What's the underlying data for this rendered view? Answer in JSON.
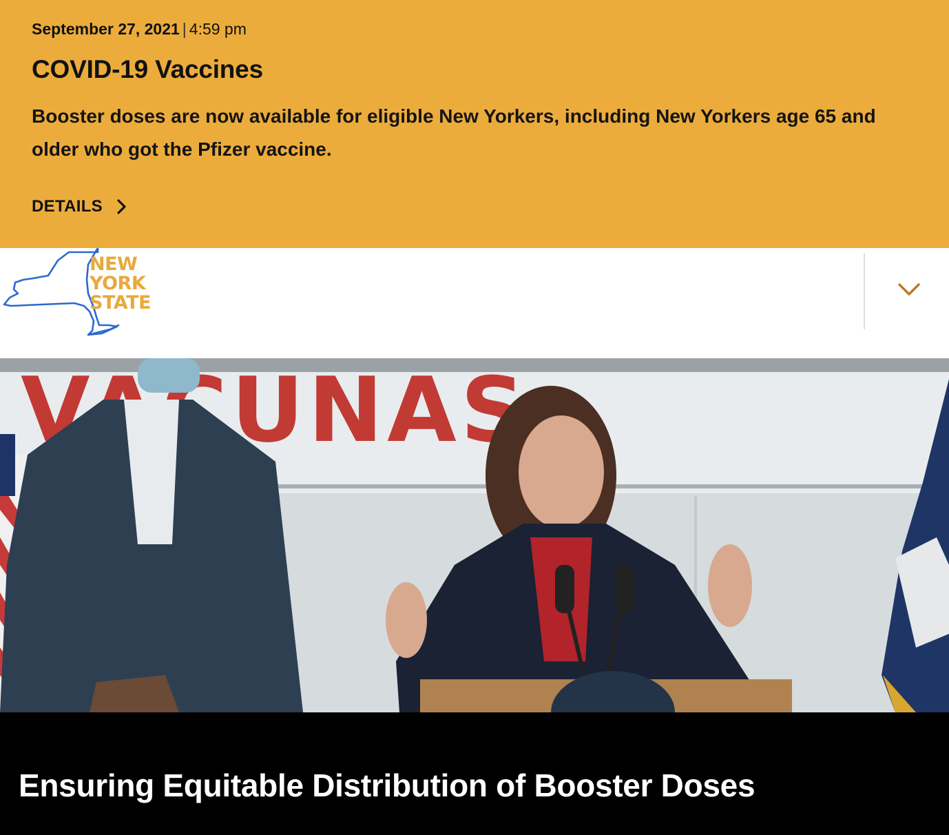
{
  "alert": {
    "date": "September 27, 2021",
    "separator": "|",
    "time": "4:59 pm",
    "title": "COVID-19 Vaccines",
    "body": "Booster doses are now available for eligible New Yorkers, including New Yorkers age 65 and older who got the Pfizer vaccine.",
    "link_label": "DETAILS",
    "link_icon": "chevron-right-icon",
    "background_color": "#ECAC3C"
  },
  "header": {
    "logo": {
      "line1": "NEW",
      "line2": "YORK",
      "line3": "STATE",
      "text_color": "#E8A93C",
      "outline_color": "#2A6ACB"
    },
    "menu_icon": "chevron-down-icon",
    "menu_icon_color": "#B97A2A"
  },
  "hero": {
    "banner_text": "VACUNAS",
    "image_alt": "Speaker at a podium in front of a vaccination banner"
  },
  "feature": {
    "title": "Ensuring Equitable Distribution of Booster Doses"
  }
}
